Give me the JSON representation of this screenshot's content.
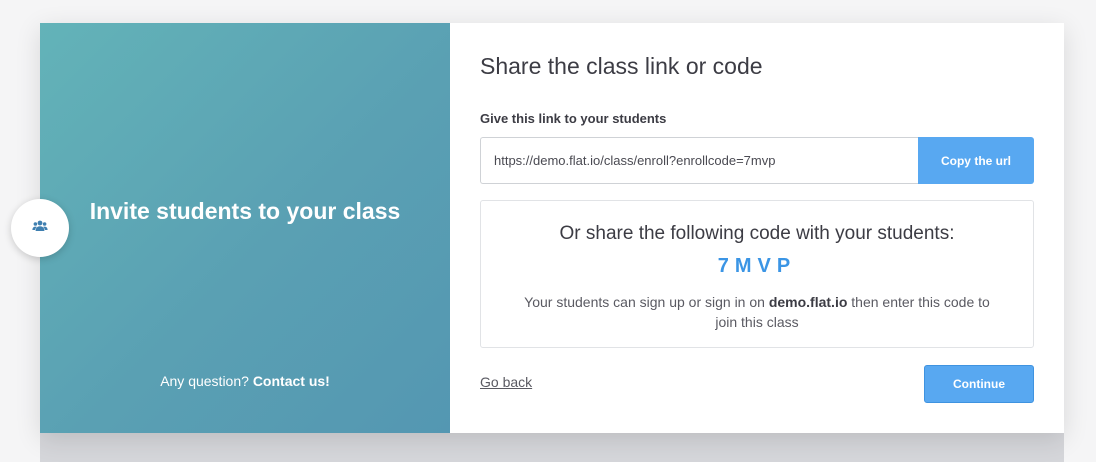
{
  "left_panel": {
    "title": "Invite students to your class",
    "footer_question": "Any question?",
    "footer_contact": "Contact us!",
    "icon": "users-icon"
  },
  "main": {
    "heading": "Share the class link or code",
    "link_label": "Give this link to your students",
    "url_value": "https://demo.flat.io/class/enroll?enrollcode=7mvp",
    "copy_button": "Copy the url",
    "code_intro": "Or share the following code with your students:",
    "code": "7MVP",
    "help_prefix": "Your students can sign up or sign in on",
    "help_domain": "demo.flat.io",
    "help_suffix": "then enter this code to join this class",
    "go_back": "Go back",
    "continue_button": "Continue"
  },
  "colors": {
    "accent": "#58a8f1",
    "code": "#3b95e5",
    "panel_gradient_start": "#63b3b8",
    "panel_gradient_end": "#5497b2"
  }
}
